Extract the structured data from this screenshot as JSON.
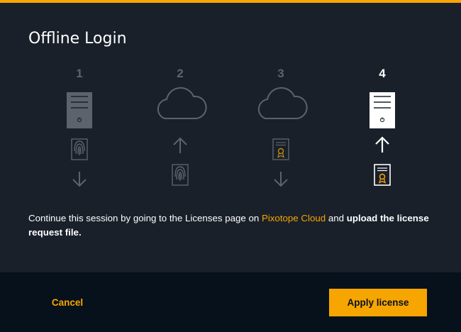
{
  "dialog": {
    "title": "Offline Login",
    "steps": [
      {
        "number": "1",
        "icons": [
          "server-icon",
          "fingerprint-file-icon",
          "arrow-down-icon"
        ]
      },
      {
        "number": "2",
        "icons": [
          "cloud-icon",
          "arrow-up-icon",
          "fingerprint-file-icon"
        ]
      },
      {
        "number": "3",
        "icons": [
          "cloud-icon",
          "certificate-file-icon",
          "arrow-down-icon"
        ]
      },
      {
        "number": "4",
        "active": true,
        "icons": [
          "server-icon",
          "arrow-up-icon",
          "certificate-file-icon"
        ]
      }
    ],
    "instruction": {
      "prefix": "Continue this session by going to the Licenses page on ",
      "link": "Pixotope Cloud",
      "middle": " and ",
      "bold": "upload the license request file."
    },
    "buttons": {
      "cancel": "Cancel",
      "apply": "Apply license"
    }
  },
  "colors": {
    "accent": "#f7a500",
    "background": "#19202a",
    "footer": "#07111b",
    "inactive": "#5b636c"
  }
}
